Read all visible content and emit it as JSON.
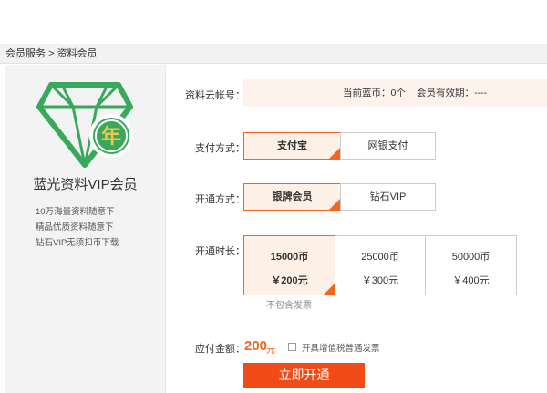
{
  "breadcrumb": {
    "home": "会员服务",
    "separator": ">",
    "current": "资料会员"
  },
  "sidebar": {
    "badge_char": "年",
    "title": "蓝光资料VIP会员",
    "features": [
      "10万海量资料随意下",
      "精品优质资料随意下",
      "钻石VIP无须扣币下载"
    ],
    "logo_color": "#3aa85a"
  },
  "account": {
    "label": "资料云帐号：",
    "coins_text": "当前蓝币：0个",
    "expiry_text": "会员有效期：----"
  },
  "payment": {
    "label": "支付方式：",
    "options": [
      {
        "label": "支付宝",
        "selected": true
      },
      {
        "label": "网银支付",
        "selected": false
      }
    ]
  },
  "plan": {
    "label": "开通方式：",
    "options": [
      {
        "label": "银牌会员",
        "selected": true
      },
      {
        "label": "钻石VIP",
        "selected": false
      }
    ]
  },
  "duration": {
    "label": "开通时长：",
    "options": [
      {
        "coins": "15000币",
        "price": "￥200元",
        "selected": true
      },
      {
        "coins": "25000币",
        "price": "￥300元",
        "selected": false
      },
      {
        "coins": "50000币",
        "price": "￥400元",
        "selected": false
      }
    ],
    "note": "不包含发票"
  },
  "payable": {
    "label": "应付金额：",
    "amount": "200",
    "unit": "元",
    "invoice_option": "开具增值税普通发票",
    "invoice_checked": false
  },
  "submit": {
    "label": "立即开通"
  },
  "colors": {
    "accent": "#f26522",
    "button": "#f14b18",
    "selected_bg": "#fdf0e6",
    "account_bg": "#fdf3ec"
  }
}
